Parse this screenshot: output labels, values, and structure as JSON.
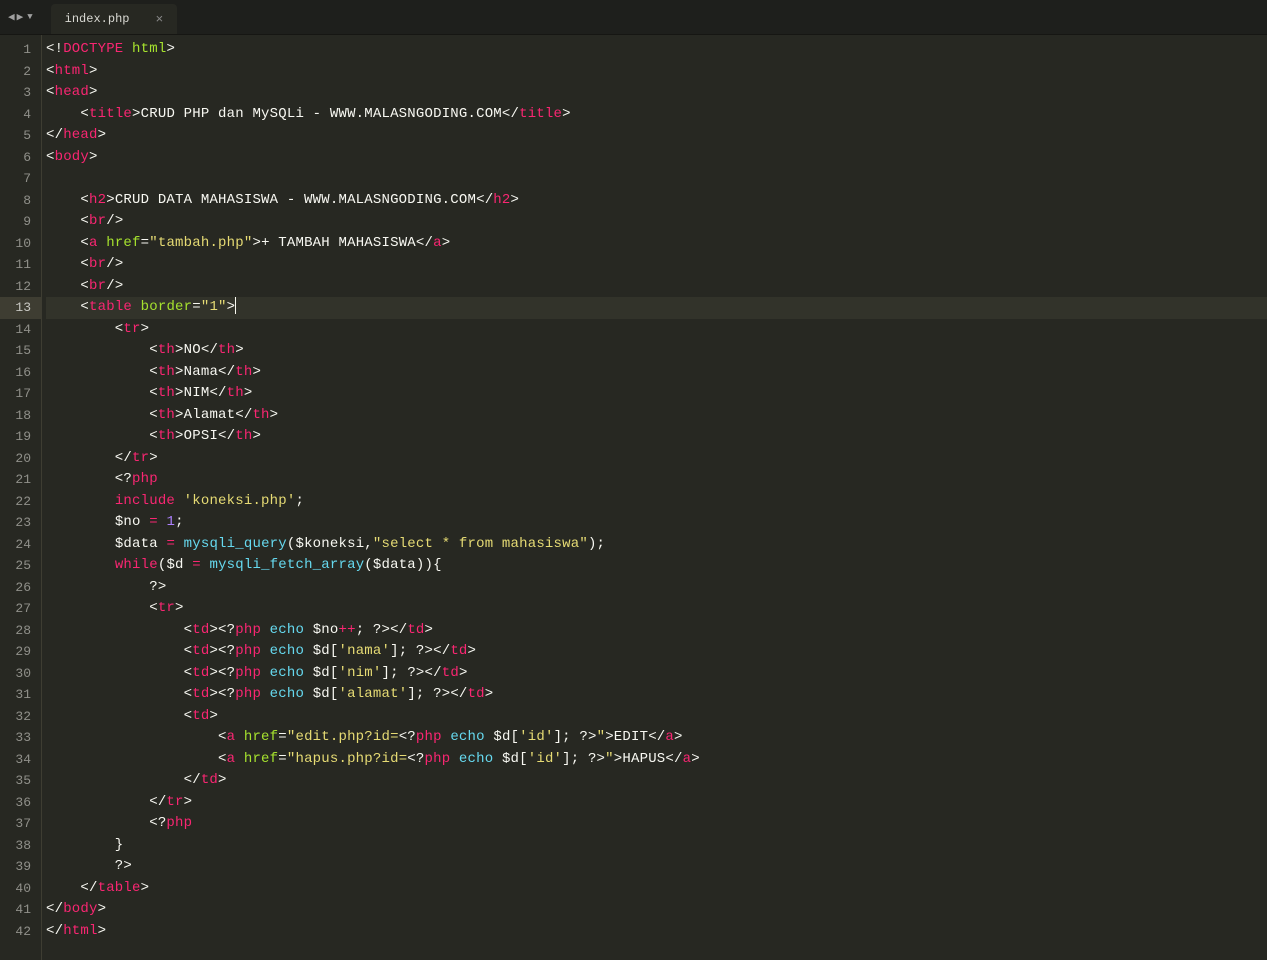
{
  "tabs": {
    "active": {
      "filename": "index.php"
    }
  },
  "activeLine": 13,
  "lines": [
    {
      "n": 1,
      "tokens": [
        {
          "c": "p",
          "t": "<!"
        },
        {
          "c": "tg",
          "t": "DOCTYPE"
        },
        {
          "c": "p",
          "t": " "
        },
        {
          "c": "at",
          "t": "html"
        },
        {
          "c": "p",
          "t": ">"
        }
      ]
    },
    {
      "n": 2,
      "tokens": [
        {
          "c": "p",
          "t": "<"
        },
        {
          "c": "tg",
          "t": "html"
        },
        {
          "c": "p",
          "t": ">"
        }
      ]
    },
    {
      "n": 3,
      "tokens": [
        {
          "c": "p",
          "t": "<"
        },
        {
          "c": "tg",
          "t": "head"
        },
        {
          "c": "p",
          "t": ">"
        }
      ]
    },
    {
      "n": 4,
      "tokens": [
        {
          "c": "p",
          "t": "    <"
        },
        {
          "c": "tg",
          "t": "title"
        },
        {
          "c": "p",
          "t": ">"
        },
        {
          "c": "tx",
          "t": "CRUD PHP dan MySQLi - WWW.MALASNGODING.COM"
        },
        {
          "c": "p",
          "t": "</"
        },
        {
          "c": "tg",
          "t": "title"
        },
        {
          "c": "p",
          "t": ">"
        }
      ]
    },
    {
      "n": 5,
      "tokens": [
        {
          "c": "p",
          "t": "</"
        },
        {
          "c": "tg",
          "t": "head"
        },
        {
          "c": "p",
          "t": ">"
        }
      ]
    },
    {
      "n": 6,
      "tokens": [
        {
          "c": "p",
          "t": "<"
        },
        {
          "c": "tg",
          "t": "body"
        },
        {
          "c": "p",
          "t": ">"
        }
      ]
    },
    {
      "n": 7,
      "tokens": []
    },
    {
      "n": 8,
      "tokens": [
        {
          "c": "p",
          "t": "    <"
        },
        {
          "c": "tg",
          "t": "h2"
        },
        {
          "c": "p",
          "t": ">"
        },
        {
          "c": "tx",
          "t": "CRUD DATA MAHASISWA - WWW.MALASNGODING.COM"
        },
        {
          "c": "p",
          "t": "</"
        },
        {
          "c": "tg",
          "t": "h2"
        },
        {
          "c": "p",
          "t": ">"
        }
      ]
    },
    {
      "n": 9,
      "tokens": [
        {
          "c": "p",
          "t": "    <"
        },
        {
          "c": "tg",
          "t": "br"
        },
        {
          "c": "p",
          "t": "/>"
        }
      ]
    },
    {
      "n": 10,
      "tokens": [
        {
          "c": "p",
          "t": "    <"
        },
        {
          "c": "tg",
          "t": "a"
        },
        {
          "c": "p",
          "t": " "
        },
        {
          "c": "at",
          "t": "href"
        },
        {
          "c": "p",
          "t": "="
        },
        {
          "c": "st",
          "t": "\"tambah.php\""
        },
        {
          "c": "p",
          "t": ">"
        },
        {
          "c": "tx",
          "t": "+ TAMBAH MAHASISWA"
        },
        {
          "c": "p",
          "t": "</"
        },
        {
          "c": "tg",
          "t": "a"
        },
        {
          "c": "p",
          "t": ">"
        }
      ]
    },
    {
      "n": 11,
      "tokens": [
        {
          "c": "p",
          "t": "    <"
        },
        {
          "c": "tg",
          "t": "br"
        },
        {
          "c": "p",
          "t": "/>"
        }
      ]
    },
    {
      "n": 12,
      "tokens": [
        {
          "c": "p",
          "t": "    <"
        },
        {
          "c": "tg",
          "t": "br"
        },
        {
          "c": "p",
          "t": "/>"
        }
      ]
    },
    {
      "n": 13,
      "tokens": [
        {
          "c": "p",
          "t": "    <"
        },
        {
          "c": "tg",
          "t": "table"
        },
        {
          "c": "p",
          "t": " "
        },
        {
          "c": "at",
          "t": "border"
        },
        {
          "c": "p",
          "t": "="
        },
        {
          "c": "st",
          "t": "\"1\""
        },
        {
          "c": "p",
          "t": ">"
        }
      ],
      "cursor": true
    },
    {
      "n": 14,
      "tokens": [
        {
          "c": "p",
          "t": "        <"
        },
        {
          "c": "tg",
          "t": "tr"
        },
        {
          "c": "p",
          "t": ">"
        }
      ]
    },
    {
      "n": 15,
      "tokens": [
        {
          "c": "p",
          "t": "            <"
        },
        {
          "c": "tg",
          "t": "th"
        },
        {
          "c": "p",
          "t": ">"
        },
        {
          "c": "tx",
          "t": "NO"
        },
        {
          "c": "p",
          "t": "</"
        },
        {
          "c": "tg",
          "t": "th"
        },
        {
          "c": "p",
          "t": ">"
        }
      ]
    },
    {
      "n": 16,
      "tokens": [
        {
          "c": "p",
          "t": "            <"
        },
        {
          "c": "tg",
          "t": "th"
        },
        {
          "c": "p",
          "t": ">"
        },
        {
          "c": "tx",
          "t": "Nama"
        },
        {
          "c": "p",
          "t": "</"
        },
        {
          "c": "tg",
          "t": "th"
        },
        {
          "c": "p",
          "t": ">"
        }
      ]
    },
    {
      "n": 17,
      "tokens": [
        {
          "c": "p",
          "t": "            <"
        },
        {
          "c": "tg",
          "t": "th"
        },
        {
          "c": "p",
          "t": ">"
        },
        {
          "c": "tx",
          "t": "NIM"
        },
        {
          "c": "p",
          "t": "</"
        },
        {
          "c": "tg",
          "t": "th"
        },
        {
          "c": "p",
          "t": ">"
        }
      ]
    },
    {
      "n": 18,
      "tokens": [
        {
          "c": "p",
          "t": "            <"
        },
        {
          "c": "tg",
          "t": "th"
        },
        {
          "c": "p",
          "t": ">"
        },
        {
          "c": "tx",
          "t": "Alamat"
        },
        {
          "c": "p",
          "t": "</"
        },
        {
          "c": "tg",
          "t": "th"
        },
        {
          "c": "p",
          "t": ">"
        }
      ]
    },
    {
      "n": 19,
      "tokens": [
        {
          "c": "p",
          "t": "            <"
        },
        {
          "c": "tg",
          "t": "th"
        },
        {
          "c": "p",
          "t": ">"
        },
        {
          "c": "tx",
          "t": "OPSI"
        },
        {
          "c": "p",
          "t": "</"
        },
        {
          "c": "tg",
          "t": "th"
        },
        {
          "c": "p",
          "t": ">"
        }
      ]
    },
    {
      "n": 20,
      "tokens": [
        {
          "c": "p",
          "t": "        </"
        },
        {
          "c": "tg",
          "t": "tr"
        },
        {
          "c": "p",
          "t": ">"
        }
      ]
    },
    {
      "n": 21,
      "tokens": [
        {
          "c": "p",
          "t": "        <?"
        },
        {
          "c": "tg",
          "t": "php"
        },
        {
          "c": "p",
          "t": " "
        }
      ]
    },
    {
      "n": 22,
      "tokens": [
        {
          "c": "p",
          "t": "        "
        },
        {
          "c": "kw2",
          "t": "include"
        },
        {
          "c": "p",
          "t": " "
        },
        {
          "c": "st",
          "t": "'koneksi.php'"
        },
        {
          "c": "p",
          "t": ";"
        }
      ]
    },
    {
      "n": 23,
      "tokens": [
        {
          "c": "p",
          "t": "        "
        },
        {
          "c": "va",
          "t": "$no"
        },
        {
          "c": "p",
          "t": " "
        },
        {
          "c": "op",
          "t": "="
        },
        {
          "c": "p",
          "t": " "
        },
        {
          "c": "nm",
          "t": "1"
        },
        {
          "c": "p",
          "t": ";"
        }
      ]
    },
    {
      "n": 24,
      "tokens": [
        {
          "c": "p",
          "t": "        "
        },
        {
          "c": "va",
          "t": "$data"
        },
        {
          "c": "p",
          "t": " "
        },
        {
          "c": "op",
          "t": "="
        },
        {
          "c": "p",
          "t": " "
        },
        {
          "c": "fn",
          "t": "mysqli_query"
        },
        {
          "c": "p",
          "t": "("
        },
        {
          "c": "va",
          "t": "$koneksi"
        },
        {
          "c": "p",
          "t": ","
        },
        {
          "c": "st",
          "t": "\"select * from mahasiswa\""
        },
        {
          "c": "p",
          "t": ");"
        }
      ]
    },
    {
      "n": 25,
      "tokens": [
        {
          "c": "p",
          "t": "        "
        },
        {
          "c": "kw2",
          "t": "while"
        },
        {
          "c": "p",
          "t": "("
        },
        {
          "c": "va",
          "t": "$d"
        },
        {
          "c": "p",
          "t": " "
        },
        {
          "c": "op",
          "t": "="
        },
        {
          "c": "p",
          "t": " "
        },
        {
          "c": "fn",
          "t": "mysqli_fetch_array"
        },
        {
          "c": "p",
          "t": "("
        },
        {
          "c": "va",
          "t": "$data"
        },
        {
          "c": "p",
          "t": ")){"
        }
      ]
    },
    {
      "n": 26,
      "tokens": [
        {
          "c": "p",
          "t": "            ?>"
        }
      ]
    },
    {
      "n": 27,
      "tokens": [
        {
          "c": "p",
          "t": "            <"
        },
        {
          "c": "tg",
          "t": "tr"
        },
        {
          "c": "p",
          "t": ">"
        }
      ]
    },
    {
      "n": 28,
      "tokens": [
        {
          "c": "p",
          "t": "                <"
        },
        {
          "c": "tg",
          "t": "td"
        },
        {
          "c": "p",
          "t": ">"
        },
        {
          "c": "p",
          "t": "<?"
        },
        {
          "c": "tg",
          "t": "php"
        },
        {
          "c": "p",
          "t": " "
        },
        {
          "c": "fn",
          "t": "echo"
        },
        {
          "c": "p",
          "t": " "
        },
        {
          "c": "va",
          "t": "$no"
        },
        {
          "c": "op",
          "t": "++"
        },
        {
          "c": "p",
          "t": "; ?>"
        },
        {
          "c": "p",
          "t": "</"
        },
        {
          "c": "tg",
          "t": "td"
        },
        {
          "c": "p",
          "t": ">"
        }
      ]
    },
    {
      "n": 29,
      "tokens": [
        {
          "c": "p",
          "t": "                <"
        },
        {
          "c": "tg",
          "t": "td"
        },
        {
          "c": "p",
          "t": ">"
        },
        {
          "c": "p",
          "t": "<?"
        },
        {
          "c": "tg",
          "t": "php"
        },
        {
          "c": "p",
          "t": " "
        },
        {
          "c": "fn",
          "t": "echo"
        },
        {
          "c": "p",
          "t": " "
        },
        {
          "c": "va",
          "t": "$d"
        },
        {
          "c": "p",
          "t": "["
        },
        {
          "c": "st",
          "t": "'nama'"
        },
        {
          "c": "p",
          "t": "]; ?>"
        },
        {
          "c": "p",
          "t": "</"
        },
        {
          "c": "tg",
          "t": "td"
        },
        {
          "c": "p",
          "t": ">"
        }
      ]
    },
    {
      "n": 30,
      "tokens": [
        {
          "c": "p",
          "t": "                <"
        },
        {
          "c": "tg",
          "t": "td"
        },
        {
          "c": "p",
          "t": ">"
        },
        {
          "c": "p",
          "t": "<?"
        },
        {
          "c": "tg",
          "t": "php"
        },
        {
          "c": "p",
          "t": " "
        },
        {
          "c": "fn",
          "t": "echo"
        },
        {
          "c": "p",
          "t": " "
        },
        {
          "c": "va",
          "t": "$d"
        },
        {
          "c": "p",
          "t": "["
        },
        {
          "c": "st",
          "t": "'nim'"
        },
        {
          "c": "p",
          "t": "]; ?>"
        },
        {
          "c": "p",
          "t": "</"
        },
        {
          "c": "tg",
          "t": "td"
        },
        {
          "c": "p",
          "t": ">"
        }
      ]
    },
    {
      "n": 31,
      "tokens": [
        {
          "c": "p",
          "t": "                <"
        },
        {
          "c": "tg",
          "t": "td"
        },
        {
          "c": "p",
          "t": ">"
        },
        {
          "c": "p",
          "t": "<?"
        },
        {
          "c": "tg",
          "t": "php"
        },
        {
          "c": "p",
          "t": " "
        },
        {
          "c": "fn",
          "t": "echo"
        },
        {
          "c": "p",
          "t": " "
        },
        {
          "c": "va",
          "t": "$d"
        },
        {
          "c": "p",
          "t": "["
        },
        {
          "c": "st",
          "t": "'alamat'"
        },
        {
          "c": "p",
          "t": "]; ?>"
        },
        {
          "c": "p",
          "t": "</"
        },
        {
          "c": "tg",
          "t": "td"
        },
        {
          "c": "p",
          "t": ">"
        }
      ]
    },
    {
      "n": 32,
      "tokens": [
        {
          "c": "p",
          "t": "                <"
        },
        {
          "c": "tg",
          "t": "td"
        },
        {
          "c": "p",
          "t": ">"
        }
      ]
    },
    {
      "n": 33,
      "tokens": [
        {
          "c": "p",
          "t": "                    <"
        },
        {
          "c": "tg",
          "t": "a"
        },
        {
          "c": "p",
          "t": " "
        },
        {
          "c": "at",
          "t": "href"
        },
        {
          "c": "p",
          "t": "="
        },
        {
          "c": "st",
          "t": "\"edit.php?id="
        },
        {
          "c": "p",
          "t": "<?"
        },
        {
          "c": "tg",
          "t": "php"
        },
        {
          "c": "p",
          "t": " "
        },
        {
          "c": "fn",
          "t": "echo"
        },
        {
          "c": "p",
          "t": " "
        },
        {
          "c": "va",
          "t": "$d"
        },
        {
          "c": "p",
          "t": "["
        },
        {
          "c": "st",
          "t": "'id'"
        },
        {
          "c": "p",
          "t": "]; ?>"
        },
        {
          "c": "st",
          "t": "\""
        },
        {
          "c": "p",
          "t": ">"
        },
        {
          "c": "tx",
          "t": "EDIT"
        },
        {
          "c": "p",
          "t": "</"
        },
        {
          "c": "tg",
          "t": "a"
        },
        {
          "c": "p",
          "t": ">"
        }
      ]
    },
    {
      "n": 34,
      "tokens": [
        {
          "c": "p",
          "t": "                    <"
        },
        {
          "c": "tg",
          "t": "a"
        },
        {
          "c": "p",
          "t": " "
        },
        {
          "c": "at",
          "t": "href"
        },
        {
          "c": "p",
          "t": "="
        },
        {
          "c": "st",
          "t": "\"hapus.php?id="
        },
        {
          "c": "p",
          "t": "<?"
        },
        {
          "c": "tg",
          "t": "php"
        },
        {
          "c": "p",
          "t": " "
        },
        {
          "c": "fn",
          "t": "echo"
        },
        {
          "c": "p",
          "t": " "
        },
        {
          "c": "va",
          "t": "$d"
        },
        {
          "c": "p",
          "t": "["
        },
        {
          "c": "st",
          "t": "'id'"
        },
        {
          "c": "p",
          "t": "]; ?>"
        },
        {
          "c": "st",
          "t": "\""
        },
        {
          "c": "p",
          "t": ">"
        },
        {
          "c": "tx",
          "t": "HAPUS"
        },
        {
          "c": "p",
          "t": "</"
        },
        {
          "c": "tg",
          "t": "a"
        },
        {
          "c": "p",
          "t": ">"
        }
      ]
    },
    {
      "n": 35,
      "tokens": [
        {
          "c": "p",
          "t": "                </"
        },
        {
          "c": "tg",
          "t": "td"
        },
        {
          "c": "p",
          "t": ">"
        }
      ]
    },
    {
      "n": 36,
      "tokens": [
        {
          "c": "p",
          "t": "            </"
        },
        {
          "c": "tg",
          "t": "tr"
        },
        {
          "c": "p",
          "t": ">"
        }
      ]
    },
    {
      "n": 37,
      "tokens": [
        {
          "c": "p",
          "t": "            <?"
        },
        {
          "c": "tg",
          "t": "php"
        },
        {
          "c": "p",
          "t": " "
        }
      ]
    },
    {
      "n": 38,
      "tokens": [
        {
          "c": "p",
          "t": "        }"
        }
      ]
    },
    {
      "n": 39,
      "tokens": [
        {
          "c": "p",
          "t": "        ?>"
        }
      ]
    },
    {
      "n": 40,
      "tokens": [
        {
          "c": "p",
          "t": "    </"
        },
        {
          "c": "tg",
          "t": "table"
        },
        {
          "c": "p",
          "t": ">"
        }
      ]
    },
    {
      "n": 41,
      "tokens": [
        {
          "c": "p",
          "t": "</"
        },
        {
          "c": "tg",
          "t": "body"
        },
        {
          "c": "p",
          "t": ">"
        }
      ]
    },
    {
      "n": 42,
      "tokens": [
        {
          "c": "p",
          "t": "</"
        },
        {
          "c": "tg",
          "t": "html"
        },
        {
          "c": "p",
          "t": ">"
        }
      ]
    }
  ]
}
